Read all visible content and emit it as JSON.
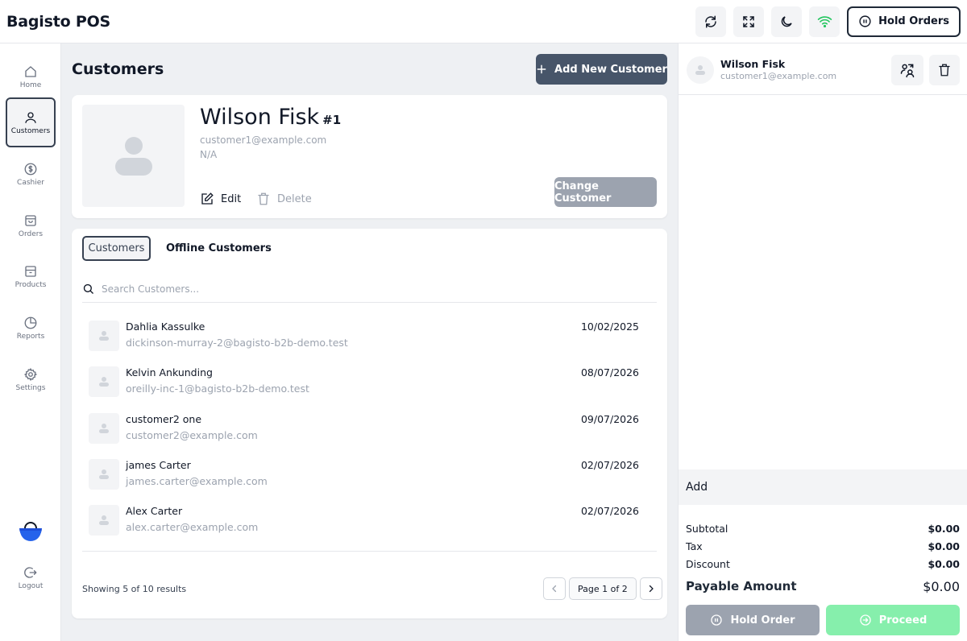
{
  "app": {
    "title": "Bagisto POS"
  },
  "topbar": {
    "icons": [
      "refresh-icon",
      "fullscreen-icon",
      "moon-icon",
      "wifi-icon"
    ],
    "hold_orders_label": "Hold Orders"
  },
  "sidebar": {
    "items": [
      {
        "label": "Home",
        "icon": "home-icon"
      },
      {
        "label": "Customers",
        "icon": "user-icon",
        "active": true
      },
      {
        "label": "Cashier",
        "icon": "dollar-icon"
      },
      {
        "label": "Orders",
        "icon": "bag-icon"
      },
      {
        "label": "Products",
        "icon": "box-icon"
      },
      {
        "label": "Reports",
        "icon": "pie-chart-icon"
      },
      {
        "label": "Settings",
        "icon": "gear-icon"
      }
    ],
    "logout_label": "Logout"
  },
  "main": {
    "page_title": "Customers",
    "add_customer_label": "Add New Customer"
  },
  "profile": {
    "name": "Wilson Fisk",
    "number": "#1",
    "email": "customer1@example.com",
    "phone": "N/A",
    "edit_label": "Edit",
    "delete_label": "Delete",
    "change_label": "Change Customer"
  },
  "list": {
    "tabs": [
      {
        "label": "Customers",
        "active": true
      },
      {
        "label": "Offline Customers",
        "active": false
      }
    ],
    "search_placeholder": "Search Customers...",
    "rows": [
      {
        "name": "Dahlia Kassulke",
        "email": "dickinson-murray-2@bagisto-b2b-demo.test",
        "date": "10/02/2025"
      },
      {
        "name": "Kelvin Ankunding",
        "email": "oreilly-inc-1@bagisto-b2b-demo.test",
        "date": "08/07/2026"
      },
      {
        "name": "customer2 one",
        "email": "customer2@example.com",
        "date": "09/07/2026"
      },
      {
        "name": "james Carter",
        "email": "james.carter@example.com",
        "date": "02/07/2026"
      },
      {
        "name": "Alex Carter",
        "email": "alex.carter@example.com",
        "date": "02/07/2026"
      }
    ],
    "showing": "Showing 5 of 10 results",
    "page_label": "Page 1 of 2"
  },
  "cart": {
    "customer_name": "Wilson Fisk",
    "customer_email": "customer1@example.com",
    "add_label": "Add",
    "subtotal_label": "Subtotal",
    "subtotal": "$0.00",
    "tax_label": "Tax",
    "tax": "$0.00",
    "discount_label": "Discount",
    "discount": "$0.00",
    "payable_label": "Payable Amount",
    "payable": "$0.00",
    "hold_order_label": "Hold Order",
    "proceed_label": "Proceed"
  },
  "colors": {
    "primary": "#475569",
    "online": "#22c55e",
    "proceed": "#86efac",
    "muted": "#9ca3af",
    "bag_blue": "#1d4ed8"
  }
}
